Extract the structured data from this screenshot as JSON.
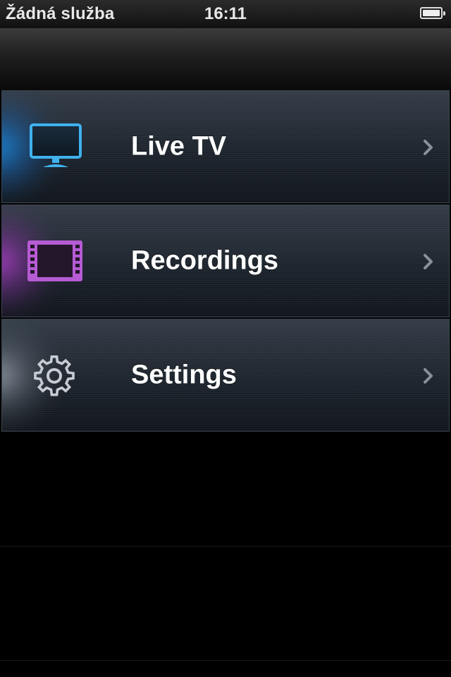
{
  "status_bar": {
    "carrier": "Žádná služba",
    "time": "16:11",
    "battery_level": 1.0
  },
  "menu": {
    "items": [
      {
        "label": "Live TV",
        "icon": "tv-monitor-icon",
        "accent": "#1ea0ff"
      },
      {
        "label": "Recordings",
        "icon": "film-strip-icon",
        "accent": "#c050e0"
      },
      {
        "label": "Settings",
        "icon": "gear-icon",
        "accent": "#c8d0dc"
      }
    ]
  },
  "colors": {
    "background": "#000000",
    "item_text": "#ffffff",
    "chevron": "#8a9097"
  }
}
